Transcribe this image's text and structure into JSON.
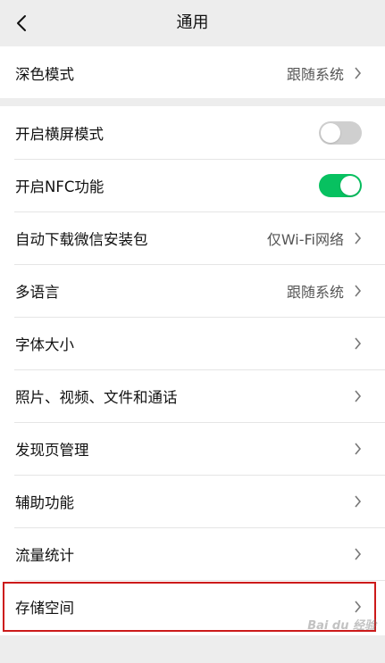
{
  "header": {
    "title": "通用",
    "back_icon": "chevron-left-icon"
  },
  "group1": {
    "items": [
      {
        "label": "深色模式",
        "value": "跟随系统"
      }
    ]
  },
  "group2": {
    "items": [
      {
        "label": "开启横屏模式",
        "toggle": "off"
      },
      {
        "label": "开启NFC功能",
        "toggle": "on"
      },
      {
        "label": "自动下载微信安装包",
        "value": "仅Wi-Fi网络"
      },
      {
        "label": "多语言",
        "value": "跟随系统"
      },
      {
        "label": "字体大小"
      },
      {
        "label": "照片、视频、文件和通话"
      },
      {
        "label": "发现页管理"
      },
      {
        "label": "辅助功能"
      },
      {
        "label": "流量统计"
      },
      {
        "label": "存储空间"
      }
    ]
  },
  "watermark": "Bai du 经验",
  "colors": {
    "accent_green": "#07c160",
    "highlight_red": "#cc1a1a",
    "background": "#ededed"
  }
}
